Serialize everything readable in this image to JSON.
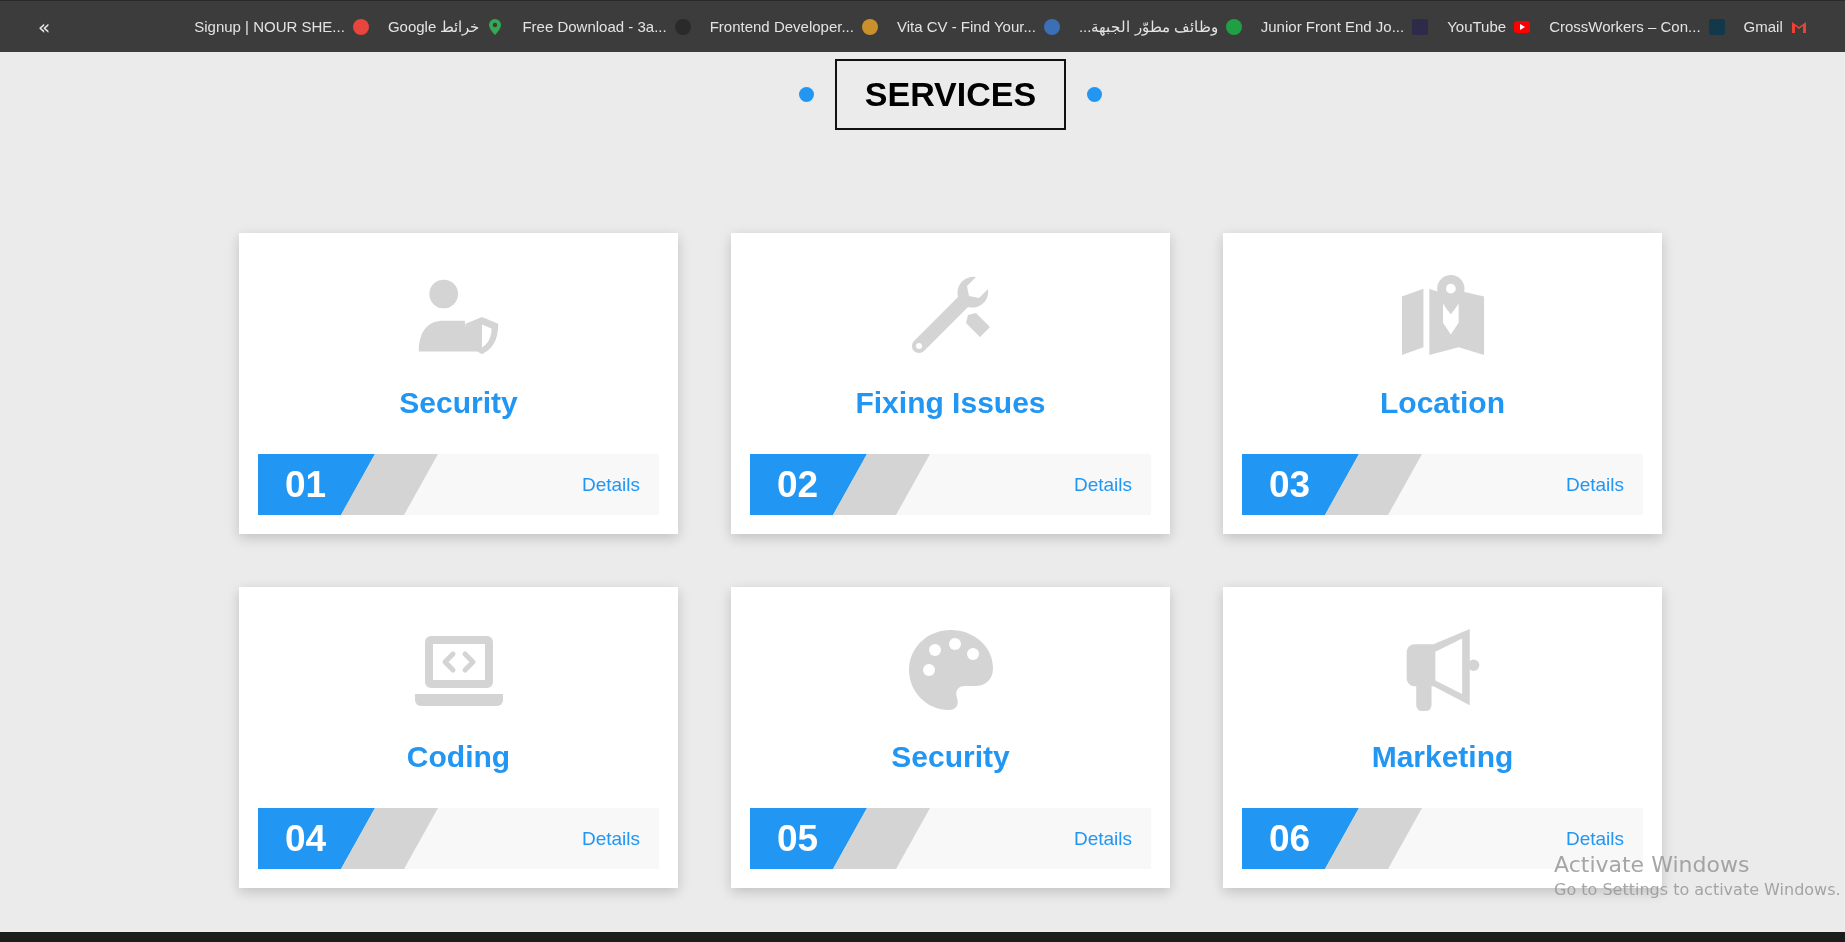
{
  "bookmarks_bar": {
    "collapse": "«",
    "items": [
      {
        "label": "Signup | NOUR SHE...",
        "kind": "disc",
        "color": "#e8453c"
      },
      {
        "label": "Google خرائط",
        "kind": "pin",
        "color": "#34a853"
      },
      {
        "label": "Free Download - 3a...",
        "kind": "disc",
        "color": "#2a2a2a"
      },
      {
        "label": "Frontend Developer...",
        "kind": "disc",
        "color": "#c9902c"
      },
      {
        "label": "Vita CV - Find Your...",
        "kind": "disc",
        "color": "#3b6fb6"
      },
      {
        "label": "وظائف  مطوّر الجبهة...",
        "kind": "disc",
        "color": "#1fa045"
      },
      {
        "label": "Junior Front End Jo...",
        "kind": "square",
        "color": "#2d2a4a"
      },
      {
        "label": "YouTube",
        "kind": "play",
        "color": "#ff0000"
      },
      {
        "label": "CrossWorkers – Con...",
        "kind": "square",
        "color": "#12394a"
      },
      {
        "label": "Gmail",
        "kind": "mail",
        "color": "#ea4335"
      }
    ]
  },
  "heading": "SERVICES",
  "services": [
    {
      "kind": "shield",
      "title": "Security",
      "number": "01",
      "link": "Details"
    },
    {
      "kind": "tools",
      "title": "Fixing Issues",
      "number": "02",
      "link": "Details"
    },
    {
      "kind": "map",
      "title": "Location",
      "number": "03",
      "link": "Details"
    },
    {
      "kind": "laptop",
      "title": "Coding",
      "number": "04",
      "link": "Details"
    },
    {
      "kind": "palette",
      "title": "Security",
      "number": "05",
      "link": "Details"
    },
    {
      "kind": "megaphone",
      "title": "Marketing",
      "number": "06",
      "link": "Details"
    }
  ],
  "os_overlay": {
    "title": "Activate Windows",
    "message": "Go to Settings to activate Windows."
  }
}
